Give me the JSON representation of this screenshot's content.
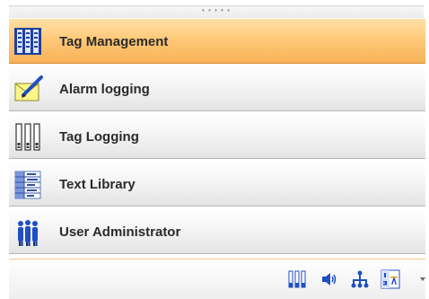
{
  "navigation": {
    "items": [
      {
        "label": "Tag Management",
        "icon": "tag-management-icon",
        "active": true
      },
      {
        "label": "Alarm logging",
        "icon": "alarm-logging-icon",
        "active": false
      },
      {
        "label": "Tag Logging",
        "icon": "tag-logging-icon",
        "active": false
      },
      {
        "label": "Text Library",
        "icon": "text-library-icon",
        "active": false
      },
      {
        "label": "User Administrator",
        "icon": "user-administrator-icon",
        "active": false
      }
    ]
  },
  "toolbar": {
    "buttons": [
      {
        "icon": "tag-logging-small-icon"
      },
      {
        "icon": "speaker-icon"
      },
      {
        "icon": "network-icon"
      },
      {
        "icon": "ordered-list-icon"
      }
    ],
    "overflow_icon": "chevron-down-icon"
  },
  "colors": {
    "active_background": "#f9b95f",
    "text": "#2a2a2a",
    "icon_blue": "#1f4fc2"
  }
}
